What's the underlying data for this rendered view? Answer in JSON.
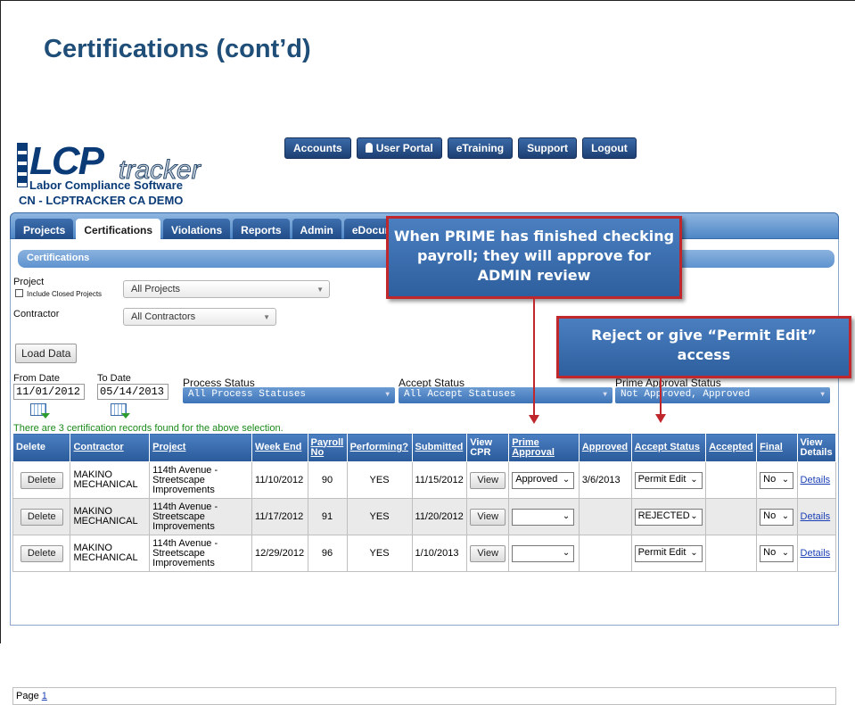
{
  "slide": {
    "title": "Certifications (cont’d)"
  },
  "logo": {
    "lcp": "LCP",
    "tracker": "tracker",
    "subtitle": "Labor Compliance Software"
  },
  "company": "CN - LCPTRACKER CA DEMO",
  "topnav": [
    "Accounts",
    "User Portal",
    "eTraining",
    "Support",
    "Logout"
  ],
  "tabs": [
    "Projects",
    "Certifications",
    "Violations",
    "Reports",
    "Admin",
    "eDocume"
  ],
  "section_title": "Certifications",
  "filters": {
    "project_label": "Project",
    "include_closed_label": "Include Closed Projects",
    "project_value": "All Projects",
    "contractor_label": "Contractor",
    "contractor_value": "All Contractors",
    "load_button": "Load Data",
    "from_label": "From Date",
    "from_value": "11/01/2012",
    "to_label": "To Date",
    "to_value": "05/14/2013",
    "process_label": "Process Status",
    "process_value": "All Process Statuses",
    "accept_label": "Accept Status",
    "accept_value": "All Accept Statuses",
    "prime_label": "Prime Approval Status",
    "prime_value": "Not Approved, Approved"
  },
  "found_text": "There are 3 certification records found for the above selection.",
  "table": {
    "headers": [
      "Delete",
      "Contractor",
      "Project",
      "Week End",
      "Payroll No",
      "Performing?",
      "Submitted",
      "View CPR",
      "Prime Approval",
      "Approved",
      "Accept Status",
      "Accepted",
      "Final",
      "View Details"
    ],
    "rows": [
      {
        "delete": "Delete",
        "contractor": "MAKINO MECHANICAL",
        "project": "114th Avenue - Streetscape Improvements",
        "week_end": "11/10/2012",
        "payroll_no": "90",
        "performing": "YES",
        "submitted": "11/15/2012",
        "view": "View",
        "prime_approval": "Approved",
        "approved": "3/6/2013",
        "accept_status": "Permit Edit",
        "accepted": "",
        "final": "No",
        "details": "Details"
      },
      {
        "delete": "Delete",
        "contractor": "MAKINO MECHANICAL",
        "project": "114th Avenue - Streetscape Improvements",
        "week_end": "11/17/2012",
        "payroll_no": "91",
        "performing": "YES",
        "submitted": "11/20/2012",
        "view": "View",
        "prime_approval": "",
        "approved": "",
        "accept_status": "REJECTED",
        "accepted": "",
        "final": "No",
        "details": "Details"
      },
      {
        "delete": "Delete",
        "contractor": "MAKINO MECHANICAL",
        "project": "114th Avenue - Streetscape Improvements",
        "week_end": "12/29/2012",
        "payroll_no": "96",
        "performing": "YES",
        "submitted": "1/10/2013",
        "view": "View",
        "prime_approval": "",
        "approved": "",
        "accept_status": "Permit Edit",
        "accepted": "",
        "final": "No",
        "details": "Details"
      }
    ]
  },
  "pager": {
    "label": "Page",
    "page": "1"
  },
  "callouts": {
    "prime": "When PRIME has finished checking payroll; they will approve for ADMIN review",
    "reject": "Reject or give “Permit Edit” access"
  },
  "colors": {
    "title": "#1f4e79",
    "nav": "#1d3f73",
    "callout_border": "#c0272d",
    "header": "#2a5a9a"
  }
}
